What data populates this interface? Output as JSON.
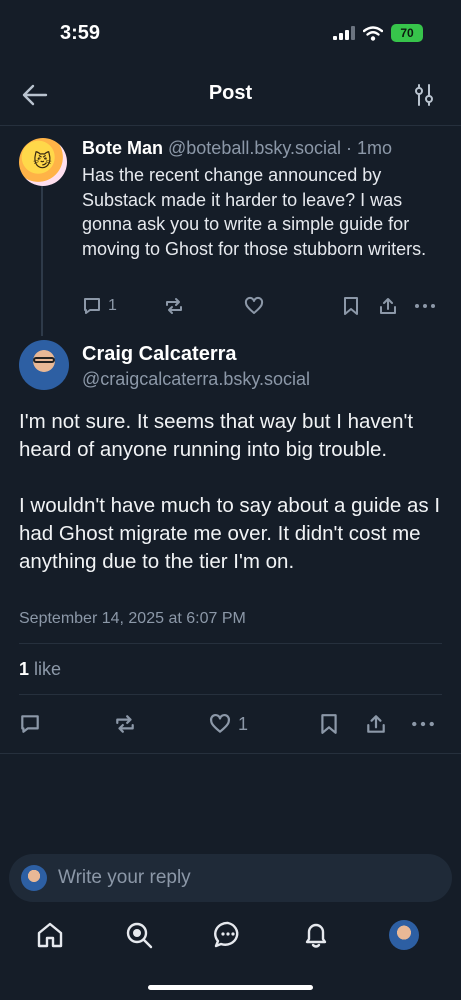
{
  "status_bar": {
    "time": "3:59",
    "battery": "70"
  },
  "header": {
    "title": "Post"
  },
  "parent_post": {
    "author_name": "Bote Man",
    "author_handle": "@boteball.bsky.social",
    "separator": " · ",
    "age": "1mo",
    "text": "Has the recent change announced by Substack made it harder to leave? I was gonna ask you to write a simple guide for moving to Ghost for those stubborn writers.",
    "reply_count": "1"
  },
  "main_post": {
    "author_name": "Craig Calcaterra",
    "author_handle": "@craigcalcaterra.bsky.social",
    "paragraphs": [
      "I'm not sure. It seems that way but I haven't heard of anyone running into big trouble.",
      "I wouldn't have much to say about a guide as I had Ghost migrate me over. It didn't cost me anything due to the tier I'm on."
    ],
    "timestamp": "September 14, 2025 at 6:07 PM",
    "like_count_number": "1",
    "like_count_word": " like",
    "like_action_count": "1"
  },
  "reply_box": {
    "placeholder": "Write your reply"
  },
  "icons": {
    "back": "arrow-left-icon",
    "filter": "sliders-icon",
    "reply": "speech-bubble-icon",
    "repost": "repost-arrows-icon",
    "like": "heart-icon",
    "bookmark": "bookmark-icon",
    "share": "share-upload-icon",
    "more": "ellipsis-icon"
  },
  "tabs": [
    "home",
    "search",
    "chat",
    "notifications",
    "profile"
  ]
}
